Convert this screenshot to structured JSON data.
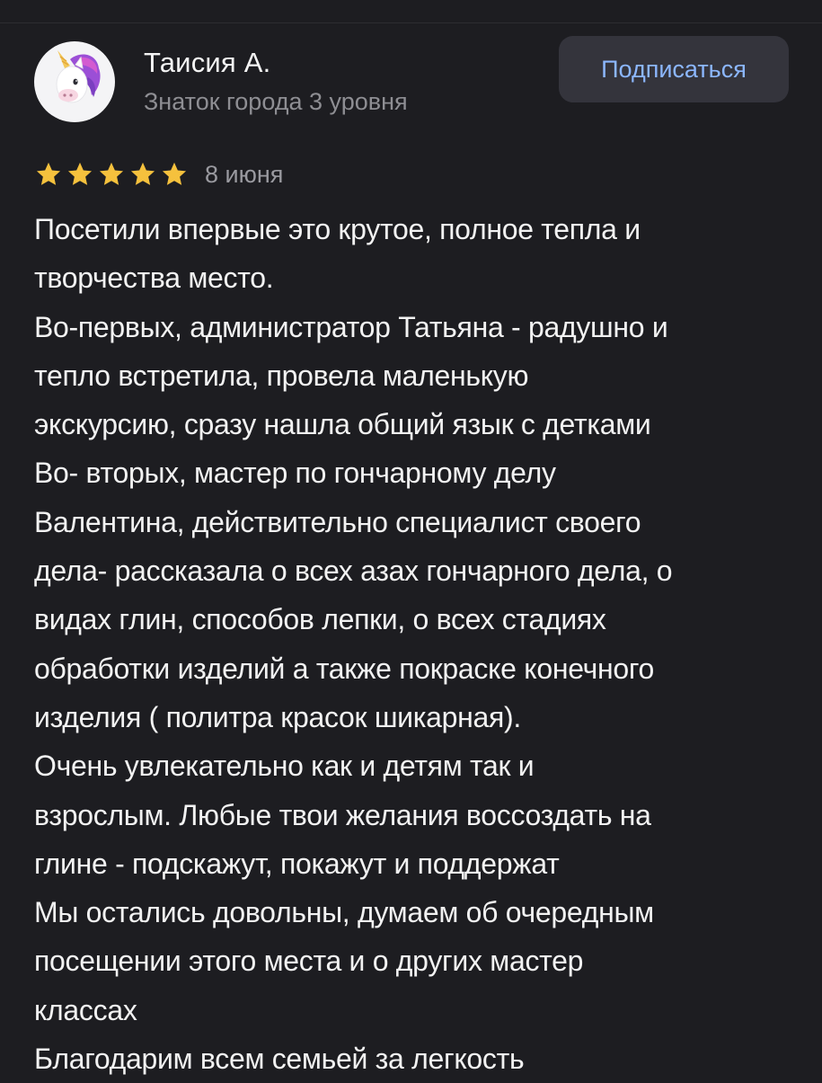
{
  "review": {
    "author": {
      "name": "Таисия А.",
      "level": "Знаток города 3 уровня",
      "avatar_icon": "unicorn-icon"
    },
    "subscribe_label": "Подписаться",
    "rating": 5,
    "rating_max": 5,
    "star_icon": "star-icon",
    "date": "8 июня",
    "text_lines": [
      "Посетили впервые это крутое, полное тепла и",
      "творчества место.",
      "Во-первых, администратор Татьяна - радушно и",
      "тепло встретила, провела маленькую",
      "экскурсию, сразу нашла общий язык с детками",
      "Во- вторых, мастер по гончарному делу",
      "Валентина, действительно специалист своего",
      "дела- рассказала о всех азах гончарного дела, о",
      "видах глин, способов лепки, о всех стадиях",
      "обработки изделий а также покраске конечного",
      "изделия ( политра красок шикарная).",
      "Очень увлекательно как и детям так и",
      "взрослым. Любые твои желания воссоздать на",
      "глине - подскажут, покажут и поддержат",
      "Мы остались довольны, думаем об очередным",
      "посещении этого места и о других мастер",
      "классах",
      "Благодарим всем семьей за легкость"
    ]
  },
  "colors": {
    "background": "#1d1d21",
    "text": "#f2f2f2",
    "muted": "#8e8e93",
    "star": "#f5c13d",
    "button_bg": "#34343c",
    "button_text": "#8cb7ff"
  }
}
